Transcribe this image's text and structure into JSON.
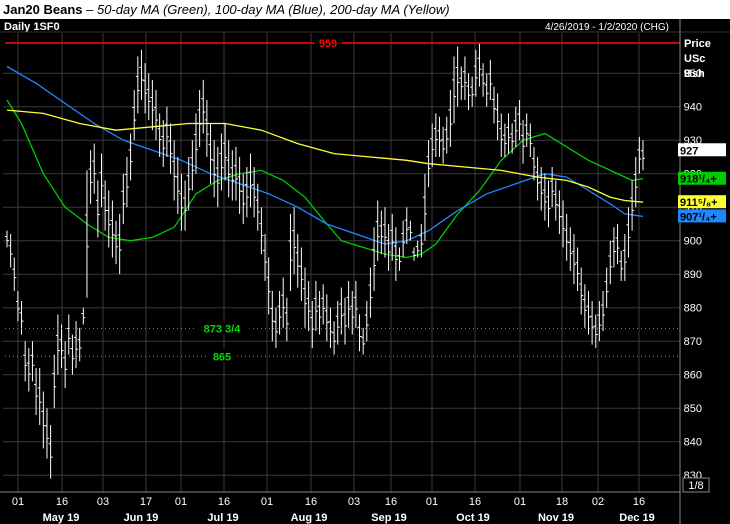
{
  "header": {
    "symbol": "Jan20 Beans",
    "separator": " – ",
    "description": "50-day MA (Green), 100-day MA (Blue), 200-day MA (Yellow)"
  },
  "chart_data": {
    "type": "ohlc-bar",
    "panel_label": "Daily 1SF0",
    "date_range": "4/26/2019 - 1/2/2020 (CHG)",
    "units_label": [
      "Price",
      "USc",
      "Bsh"
    ],
    "corner_label": "1/8",
    "ylim": [
      825,
      962
    ],
    "y_ticks": [
      830,
      840,
      850,
      860,
      870,
      880,
      890,
      900,
      910,
      920,
      930,
      940,
      950
    ],
    "x_day_ticks": [
      "01",
      "16",
      "03",
      "17",
      "01",
      "16",
      "01",
      "16",
      "03",
      "16",
      "01",
      "16",
      "01",
      "18",
      "02",
      "16"
    ],
    "x_month_labels": [
      "May 19",
      "Jun 19",
      "Jul 19",
      "Aug 19",
      "Sep 19",
      "Oct 19",
      "Nov 19",
      "Dec 19"
    ],
    "grid": true,
    "colors": {
      "background": "#000000",
      "grid": "#3a3a3a",
      "bars": "#ffffff",
      "ma50": "#00cc00",
      "ma100": "#1e88ff",
      "ma200": "#ffff33",
      "resistance": "#ff0000",
      "support": "#00dd00"
    },
    "horizontal_lines": [
      {
        "label": "959",
        "value": 959,
        "style": "solid",
        "color": "#ff0000"
      },
      {
        "label": "873 3/4",
        "value": 873.75,
        "style": "dotted",
        "color": "#00dd00"
      },
      {
        "label": "865",
        "value": 865.5,
        "style": "dotted",
        "color": "#00dd00"
      }
    ],
    "price_markers": [
      {
        "label": "927",
        "value": 927,
        "bg": "#ffffff",
        "fg": "#000000"
      },
      {
        "label": "918¹/₄+",
        "value": 918.5,
        "bg": "#00cc00",
        "fg": "#000000"
      },
      {
        "label": "911⁵/₈+",
        "value": 911.5,
        "bg": "#ffff33",
        "fg": "#000000"
      },
      {
        "label": "907¹/₄+",
        "value": 907.25,
        "bg": "#1e88ff",
        "fg": "#000000"
      }
    ],
    "series": [
      {
        "name": "Jan20 Beans",
        "type": "ohlc",
        "bars": [
          [
            903,
            898
          ],
          [
            902,
            892
          ],
          [
            895,
            885
          ],
          [
            885,
            876
          ],
          [
            882,
            872
          ],
          [
            870,
            858
          ],
          [
            868,
            855
          ],
          [
            870,
            858
          ],
          [
            862,
            848
          ],
          [
            862,
            845
          ],
          [
            855,
            838
          ],
          [
            850,
            835
          ],
          [
            845,
            829
          ],
          [
            866,
            850
          ],
          [
            878,
            860
          ],
          [
            875,
            862
          ],
          [
            870,
            856
          ],
          [
            878,
            866
          ],
          [
            872,
            860
          ],
          [
            876,
            862
          ],
          [
            874,
            864
          ],
          [
            880,
            875
          ],
          [
            921,
            883
          ],
          [
            927,
            911
          ],
          [
            929,
            914
          ],
          [
            918,
            901
          ],
          [
            926,
            910
          ],
          [
            918,
            903
          ],
          [
            915,
            898
          ],
          [
            912,
            895
          ],
          [
            906,
            893
          ],
          [
            908,
            890
          ],
          [
            920,
            905
          ],
          [
            925,
            910
          ],
          [
            932,
            918
          ],
          [
            945,
            930
          ],
          [
            955,
            938
          ],
          [
            957,
            942
          ],
          [
            953,
            938
          ],
          [
            950,
            936
          ],
          [
            948,
            933
          ],
          [
            945,
            930
          ],
          [
            938,
            925
          ],
          [
            936,
            922
          ],
          [
            940,
            925
          ],
          [
            935,
            920
          ],
          [
            930,
            912
          ],
          [
            925,
            908
          ],
          [
            920,
            903
          ],
          [
            918,
            903
          ],
          [
            925,
            909
          ],
          [
            930,
            915
          ],
          [
            938,
            920
          ],
          [
            945,
            928
          ],
          [
            948,
            932
          ],
          [
            942,
            925
          ],
          [
            935,
            917
          ],
          [
            930,
            913
          ],
          [
            928,
            910
          ],
          [
            932,
            915
          ],
          [
            935,
            918
          ],
          [
            930,
            913
          ],
          [
            927,
            912
          ],
          [
            928,
            912
          ],
          [
            925,
            908
          ],
          [
            920,
            905
          ],
          [
            922,
            907
          ],
          [
            926,
            910
          ],
          [
            922,
            907
          ],
          [
            917,
            903
          ],
          [
            910,
            896
          ],
          [
            902,
            888
          ],
          [
            895,
            878
          ],
          [
            885,
            870
          ],
          [
            880,
            868
          ],
          [
            885,
            872
          ],
          [
            889,
            874
          ],
          [
            883,
            870
          ],
          [
            908,
            885
          ],
          [
            910,
            890
          ],
          [
            902,
            886
          ],
          [
            898,
            882
          ],
          [
            892,
            874
          ],
          [
            888,
            873
          ],
          [
            882,
            868
          ],
          [
            888,
            873
          ],
          [
            885,
            872
          ],
          [
            887,
            875
          ],
          [
            884,
            870
          ],
          [
            880,
            868
          ],
          [
            876,
            866
          ],
          [
            882,
            869
          ],
          [
            886,
            872
          ],
          [
            883,
            869
          ],
          [
            888,
            874
          ],
          [
            885,
            872
          ],
          [
            888,
            874
          ],
          [
            878,
            867
          ],
          [
            874,
            866
          ],
          [
            882,
            870
          ],
          [
            892,
            877
          ],
          [
            904,
            885
          ],
          [
            912,
            894
          ],
          [
            909,
            896
          ],
          [
            910,
            895
          ],
          [
            905,
            891
          ],
          [
            908,
            894
          ],
          [
            904,
            888
          ],
          [
            898,
            891
          ],
          [
            906,
            895
          ],
          [
            910,
            899
          ],
          [
            906,
            900
          ],
          [
            898,
            894
          ],
          [
            900,
            895
          ],
          [
            905,
            895
          ],
          [
            920,
            900
          ],
          [
            930,
            916
          ],
          [
            935,
            922
          ],
          [
            938,
            925
          ],
          [
            937,
            925
          ],
          [
            934,
            923
          ],
          [
            937,
            926
          ],
          [
            945,
            928
          ],
          [
            955,
            935
          ],
          [
            958,
            940
          ],
          [
            952,
            942
          ],
          [
            955,
            942
          ],
          [
            950,
            939
          ],
          [
            949,
            940
          ],
          [
            957,
            943
          ],
          [
            959,
            946
          ],
          [
            953,
            943
          ],
          [
            950,
            940
          ],
          [
            954,
            942
          ],
          [
            946,
            935
          ],
          [
            944,
            930
          ],
          [
            938,
            925
          ],
          [
            935,
            925
          ],
          [
            938,
            926
          ],
          [
            935,
            926
          ],
          [
            940,
            928
          ],
          [
            942,
            930
          ],
          [
            936,
            923
          ],
          [
            938,
            928
          ],
          [
            935,
            925
          ],
          [
            928,
            918
          ],
          [
            925,
            912
          ],
          [
            922,
            909
          ],
          [
            920,
            906
          ],
          [
            918,
            904
          ],
          [
            922,
            910
          ],
          [
            918,
            906
          ],
          [
            915,
            902
          ],
          [
            912,
            898
          ],
          [
            908,
            894
          ],
          [
            904,
            891
          ],
          [
            902,
            887
          ],
          [
            898,
            885
          ],
          [
            892,
            878
          ],
          [
            887,
            874
          ],
          [
            885,
            872
          ],
          [
            882,
            869
          ],
          [
            878,
            868
          ],
          [
            882,
            870
          ],
          [
            885,
            873
          ],
          [
            892,
            880
          ],
          [
            900,
            887
          ],
          [
            904,
            892
          ],
          [
            905,
            893
          ],
          [
            897,
            888
          ],
          [
            902,
            888
          ],
          [
            910,
            895
          ],
          [
            918,
            903
          ],
          [
            925,
            910
          ],
          [
            931,
            920
          ],
          [
            930,
            921
          ]
        ]
      },
      {
        "name": "50-day MA",
        "type": "line",
        "color": "#00cc00",
        "values": [
          [
            0,
            942
          ],
          [
            4,
            935
          ],
          [
            10,
            920
          ],
          [
            16,
            910
          ],
          [
            22,
            905
          ],
          [
            28,
            901
          ],
          [
            34,
            900
          ],
          [
            40,
            901
          ],
          [
            46,
            904
          ],
          [
            52,
            914
          ],
          [
            58,
            918
          ],
          [
            64,
            920
          ],
          [
            70,
            921
          ],
          [
            76,
            918
          ],
          [
            82,
            913
          ],
          [
            88,
            905
          ],
          [
            92,
            900
          ],
          [
            98,
            898
          ],
          [
            104,
            896
          ],
          [
            110,
            895
          ],
          [
            114,
            896
          ],
          [
            118,
            899
          ],
          [
            124,
            908
          ],
          [
            130,
            915
          ],
          [
            136,
            924
          ],
          [
            142,
            930
          ],
          [
            148,
            932
          ],
          [
            154,
            928
          ],
          [
            160,
            924
          ],
          [
            166,
            921
          ],
          [
            172,
            918
          ],
          [
            175,
            918.5
          ]
        ]
      },
      {
        "name": "100-day MA",
        "type": "line",
        "color": "#1e88ff",
        "values": [
          [
            0,
            952
          ],
          [
            8,
            947
          ],
          [
            16,
            941
          ],
          [
            24,
            935
          ],
          [
            32,
            930
          ],
          [
            40,
            927
          ],
          [
            48,
            924
          ],
          [
            56,
            920
          ],
          [
            64,
            917
          ],
          [
            72,
            914
          ],
          [
            80,
            910
          ],
          [
            88,
            905
          ],
          [
            96,
            902
          ],
          [
            104,
            899
          ],
          [
            110,
            900
          ],
          [
            116,
            903
          ],
          [
            124,
            909
          ],
          [
            132,
            914
          ],
          [
            140,
            917
          ],
          [
            148,
            920
          ],
          [
            154,
            919
          ],
          [
            160,
            915
          ],
          [
            166,
            911
          ],
          [
            170,
            908
          ],
          [
            175,
            907.25
          ]
        ]
      },
      {
        "name": "200-day MA",
        "type": "line",
        "color": "#ffff33",
        "values": [
          [
            0,
            939
          ],
          [
            10,
            938
          ],
          [
            20,
            935
          ],
          [
            30,
            933
          ],
          [
            40,
            934
          ],
          [
            50,
            935
          ],
          [
            60,
            935
          ],
          [
            70,
            933
          ],
          [
            80,
            929
          ],
          [
            90,
            926
          ],
          [
            100,
            925
          ],
          [
            110,
            924
          ],
          [
            116,
            923
          ],
          [
            126,
            922
          ],
          [
            136,
            921
          ],
          [
            146,
            919
          ],
          [
            154,
            918
          ],
          [
            160,
            916
          ],
          [
            166,
            913
          ],
          [
            170,
            912
          ],
          [
            175,
            911.5
          ]
        ]
      }
    ]
  }
}
